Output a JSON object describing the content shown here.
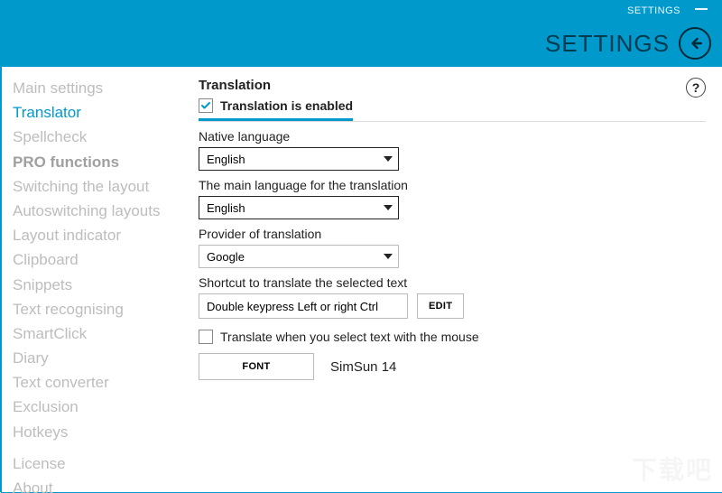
{
  "header": {
    "tiny": "SETTINGS",
    "title": "SETTINGS"
  },
  "sidebar": {
    "items": [
      {
        "label": "Main settings",
        "active": false,
        "bold": false
      },
      {
        "label": "Translator",
        "active": true,
        "bold": false
      },
      {
        "label": "Spellcheck",
        "active": false,
        "bold": false
      },
      {
        "label": "PRO functions",
        "active": false,
        "bold": true
      },
      {
        "label": "Switching the layout",
        "active": false,
        "bold": false
      },
      {
        "label": "Autoswitching layouts",
        "active": false,
        "bold": false
      },
      {
        "label": "Layout indicator",
        "active": false,
        "bold": false
      },
      {
        "label": "Clipboard",
        "active": false,
        "bold": false
      },
      {
        "label": "Snippets",
        "active": false,
        "bold": false
      },
      {
        "label": "Text recognising",
        "active": false,
        "bold": false
      },
      {
        "label": "SmartClick",
        "active": false,
        "bold": false
      },
      {
        "label": "Diary",
        "active": false,
        "bold": false
      },
      {
        "label": "Text converter",
        "active": false,
        "bold": false
      },
      {
        "label": "Exclusion",
        "active": false,
        "bold": false
      },
      {
        "label": "Hotkeys",
        "active": false,
        "bold": false
      }
    ],
    "bottom_items": [
      {
        "label": "License"
      },
      {
        "label": "About"
      }
    ]
  },
  "content": {
    "section_title": "Translation",
    "enabled_label": "Translation is enabled",
    "enabled_checked": true,
    "native_language_label": "Native language",
    "native_language_value": "English",
    "main_language_label": "The main language for the translation",
    "main_language_value": "English",
    "provider_label": "Provider of translation",
    "provider_value": "Google",
    "shortcut_label": "Shortcut to translate the selected text",
    "shortcut_value": "Double keypress Left or right Ctrl",
    "edit_button": "EDIT",
    "translate_on_select_label": "Translate when you select text with the mouse",
    "translate_on_select_checked": false,
    "font_button": "FONT",
    "font_display": "SimSun 14",
    "help_tooltip": "?"
  }
}
